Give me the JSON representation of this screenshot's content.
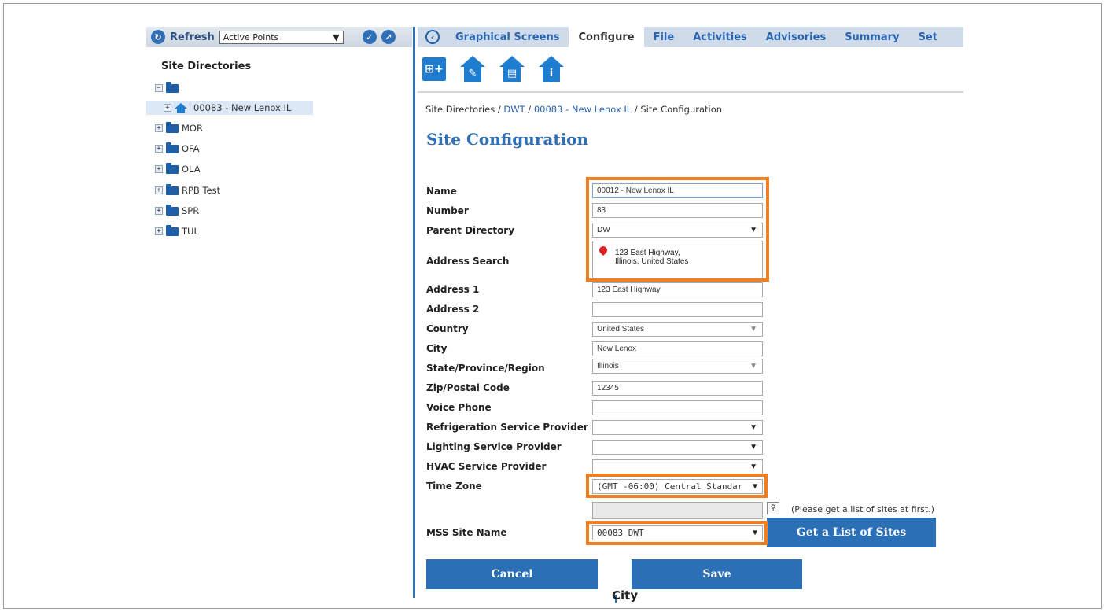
{
  "left_panel": {
    "refresh_label": "Refresh",
    "points_select": "Active Points",
    "title": "Site Directories",
    "tree": [
      {
        "label": ""
      },
      {
        "label": "00083 - New Lenox IL"
      },
      {
        "label": "MOR"
      },
      {
        "label": "OFA"
      },
      {
        "label": "OLA"
      },
      {
        "label": "RPB Test"
      },
      {
        "label": "SPR"
      },
      {
        "label": "TUL"
      }
    ]
  },
  "nav": {
    "tabs": [
      "Graphical Screens",
      "Configure",
      "File",
      "Activities",
      "Advisories",
      "Summary",
      "Set"
    ]
  },
  "breadcrumb": {
    "root": "Site Directories",
    "sep": " / ",
    "dir": "DWT",
    "site": "00083 - New Lenox IL",
    "page": "Site Configuration"
  },
  "page_title": "Site Configuration",
  "form": {
    "labels": {
      "name": "Name",
      "number": "Number",
      "parent": "Parent Directory",
      "address_search": "Address Search",
      "address1": "Address 1",
      "address2": "Address 2",
      "country": "Country",
      "city": "City",
      "state": "State/Province/Region",
      "zip": "Zip/Postal Code",
      "voice": "Voice Phone",
      "refrig": "Refrigeration Service Provider",
      "lighting": "Lighting Service Provider",
      "hvac": "HVAC Service Provider",
      "timezone": "Time Zone",
      "mss": "MSS Site Name"
    },
    "values": {
      "name": "00012 - New Lenox IL",
      "number": "83",
      "parent": "DW",
      "address_search": "123 East Highway,\nIllinois, United States",
      "address1": "123 East Highway",
      "address2": "",
      "country": "United States",
      "city": "New Lenox",
      "state": "Illinois",
      "zip": "12345",
      "voice": "",
      "refrig": "",
      "lighting": "",
      "hvac": "",
      "timezone": "(GMT -06:00) Central Standar",
      "mss": "00083 DWT"
    },
    "caret": "▼",
    "mss_hint": "(Please get a list of sites at first.)",
    "get_list_button": "Get a List of Sites"
  },
  "buttons": {
    "cancel": "Cancel",
    "save": "Save"
  },
  "fragment": "City",
  "colors": {
    "accent": "#2b6fb6",
    "highlight": "#f07f22"
  }
}
